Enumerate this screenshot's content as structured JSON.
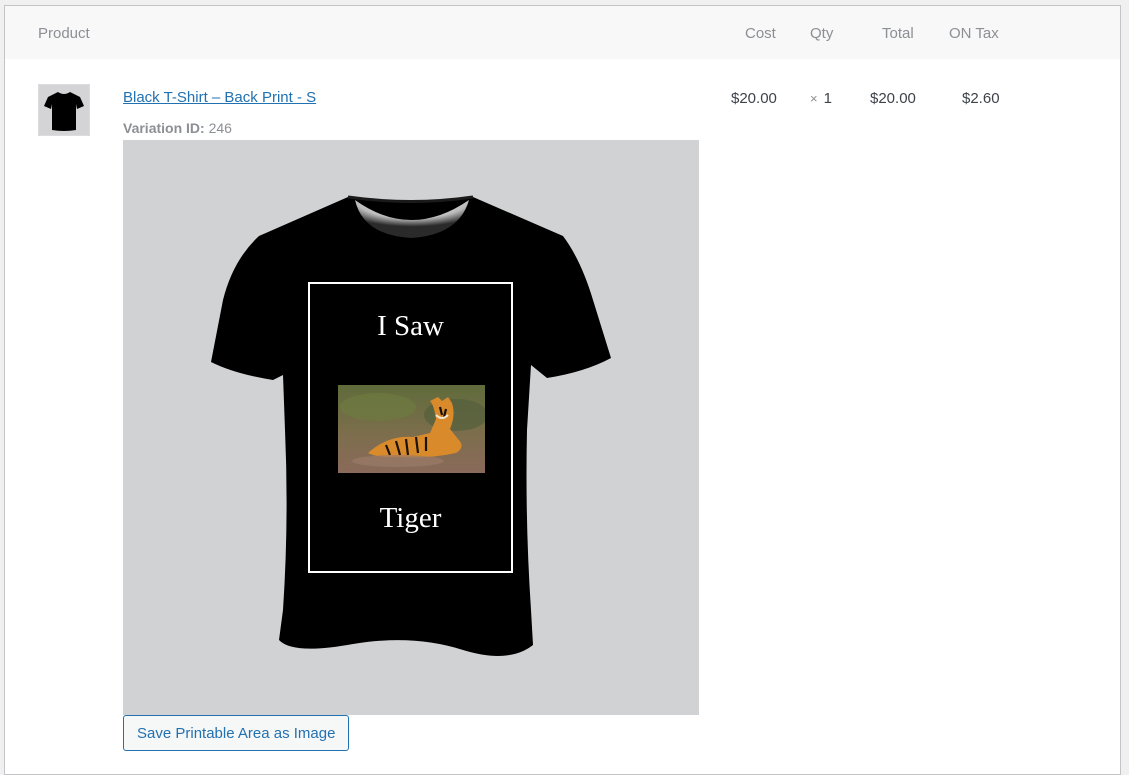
{
  "table": {
    "headers": {
      "product": "Product",
      "cost": "Cost",
      "qty": "Qty",
      "total": "Total",
      "tax": "ON Tax"
    }
  },
  "item": {
    "name": "Black T-Shirt – Back Print - S",
    "variation_label": "Variation ID:",
    "variation_id": "246",
    "cost": "$20.00",
    "qty_prefix": "×",
    "qty": "1",
    "total": "$20.00",
    "tax": "$2.60"
  },
  "preview": {
    "line1": "I Saw",
    "line2": "Tiger",
    "shirt_color": "#000000",
    "background_color": "#d1d2d4"
  },
  "actions": {
    "save_label": "Save Printable Area as Image"
  },
  "icons": {
    "thumbnail": "tshirt-thumbnail-icon"
  }
}
